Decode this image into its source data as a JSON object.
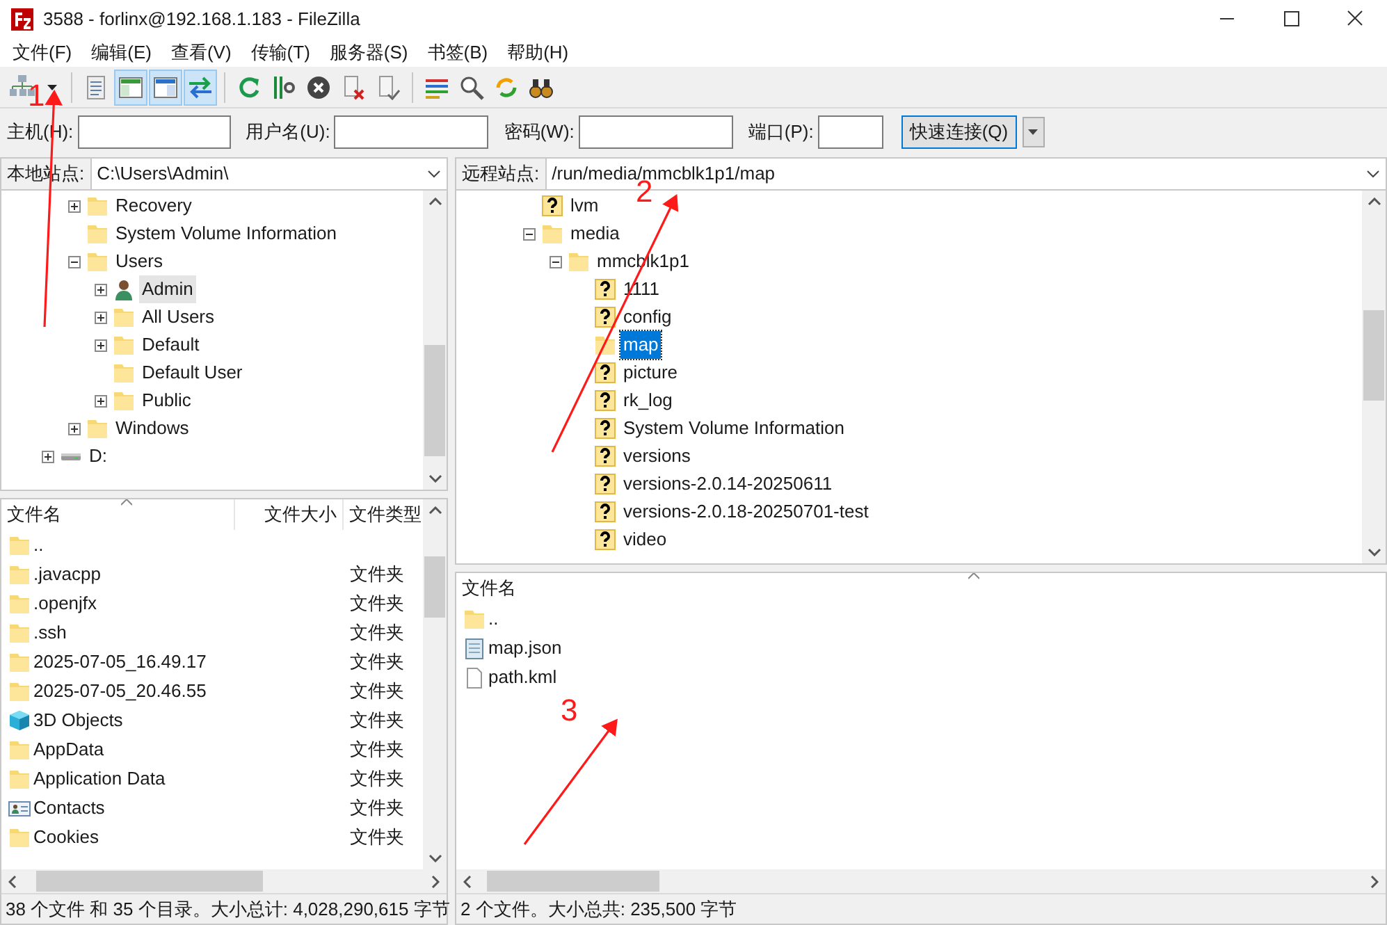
{
  "window": {
    "title": "3588 - forlinx@192.168.1.183 - FileZilla"
  },
  "menu": [
    "文件(F)",
    "编辑(E)",
    "查看(V)",
    "传输(T)",
    "服务器(S)",
    "书签(B)",
    "帮助(H)"
  ],
  "toolbar": [
    {
      "kind": "button",
      "on": false
    },
    {
      "kind": "dropdown"
    },
    {
      "kind": "separator"
    },
    {
      "kind": "button",
      "on": false
    },
    {
      "kind": "button",
      "on": true
    },
    {
      "kind": "button",
      "on": true
    },
    {
      "kind": "button",
      "on": true
    },
    {
      "kind": "separator"
    },
    {
      "kind": "button",
      "on": false
    },
    {
      "kind": "button",
      "on": false
    },
    {
      "kind": "button",
      "on": false
    },
    {
      "kind": "button",
      "on": false
    },
    {
      "kind": "button",
      "on": false
    },
    {
      "kind": "separator"
    },
    {
      "kind": "button",
      "on": false
    },
    {
      "kind": "button",
      "on": false
    },
    {
      "kind": "button",
      "on": false
    },
    {
      "kind": "button",
      "on": false
    }
  ],
  "quickconnect": {
    "fields": [
      {
        "label": "主机(H):"
      },
      {
        "label": "用户名(U):"
      },
      {
        "label": "密码(W):"
      },
      {
        "label": "端口(P):"
      }
    ],
    "button": "快速连接(Q)"
  },
  "local": {
    "label": "本地站点:",
    "path": "C:\\Users\\Admin\\",
    "focused": false,
    "tree": [
      {
        "children": [
          {
            "label": "Recovery",
            "kind": "folder",
            "expanded": false,
            "selected": false
          },
          {
            "label": "System Volume Information",
            "kind": "folder",
            "selected": false
          },
          {
            "label": "Users",
            "kind": "folder",
            "expanded": true,
            "selected": false,
            "children": [
              {
                "label": "Admin",
                "kind": "user",
                "expanded": false,
                "selected": true
              },
              {
                "label": "All Users",
                "kind": "folder",
                "expanded": false,
                "selected": false
              },
              {
                "label": "Default",
                "kind": "folder",
                "expanded": false,
                "selected": false
              },
              {
                "label": "Default User",
                "kind": "folder",
                "selected": false
              },
              {
                "label": "Public",
                "kind": "folder",
                "expanded": false,
                "selected": false
              }
            ]
          },
          {
            "label": "Windows",
            "kind": "folder",
            "expanded": false,
            "selected": false
          }
        ]
      },
      {
        "label": "D:",
        "kind": "drive",
        "expanded": false,
        "selected": false
      }
    ],
    "columns": [
      "文件名",
      "文件大小",
      "文件类型"
    ],
    "files": [
      {
        "name": "..",
        "kind": "folder"
      },
      {
        "name": ".javacpp",
        "kind": "folder",
        "type": "文件夹"
      },
      {
        "name": ".openjfx",
        "kind": "folder",
        "type": "文件夹"
      },
      {
        "name": ".ssh",
        "kind": "folder",
        "type": "文件夹"
      },
      {
        "name": "2025-07-05_16.49.17",
        "kind": "folder",
        "type": "文件夹"
      },
      {
        "name": "2025-07-05_20.46.55",
        "kind": "folder",
        "type": "文件夹"
      },
      {
        "name": "3D Objects",
        "kind": "cube",
        "type": "文件夹"
      },
      {
        "name": "AppData",
        "kind": "folder",
        "type": "文件夹"
      },
      {
        "name": "Application Data",
        "kind": "folder",
        "type": "文件夹"
      },
      {
        "name": "Contacts",
        "kind": "contacts",
        "type": "文件夹"
      },
      {
        "name": "Cookies",
        "kind": "folder",
        "type": "文件夹"
      }
    ],
    "status": "38 个文件 和 35 个目录。大小总计: 4,028,290,615 字节"
  },
  "remote": {
    "label": "远程站点:",
    "path": "/run/media/mmcblk1p1/map",
    "focused": true,
    "tree": [
      {
        "children": [
          {
            "label": "lvm",
            "kind": "unknown",
            "selected": false
          },
          {
            "label": "media",
            "kind": "folder",
            "expanded": true,
            "selected": false,
            "children": [
              {
                "label": "mmcblk1p1",
                "kind": "folder",
                "expanded": true,
                "selected": false,
                "children": [
                  {
                    "label": "1111",
                    "kind": "unknown",
                    "selected": false
                  },
                  {
                    "label": "config",
                    "kind": "unknown",
                    "selected": false
                  },
                  {
                    "label": "map",
                    "kind": "folder",
                    "selected": true
                  },
                  {
                    "label": "picture",
                    "kind": "unknown",
                    "selected": false
                  },
                  {
                    "label": "rk_log",
                    "kind": "unknown",
                    "selected": false
                  },
                  {
                    "label": "System Volume Information",
                    "kind": "unknown",
                    "selected": false
                  },
                  {
                    "label": "versions",
                    "kind": "unknown",
                    "selected": false
                  },
                  {
                    "label": "versions-2.0.14-20250611",
                    "kind": "unknown",
                    "selected": false
                  },
                  {
                    "label": "versions-2.0.18-20250701-test",
                    "kind": "unknown",
                    "selected": false
                  },
                  {
                    "label": "video",
                    "kind": "unknown",
                    "selected": false
                  }
                ]
              }
            ]
          }
        ]
      }
    ],
    "columns": [
      "文件名"
    ],
    "files": [
      {
        "name": "..",
        "kind": "folder"
      },
      {
        "name": "map.json",
        "kind": "text-file"
      },
      {
        "name": "path.kml",
        "kind": "file"
      }
    ],
    "status": "2 个文件。大小总共: 235,500 字节"
  },
  "annotations": [
    {
      "label": "1"
    },
    {
      "label": "2"
    },
    {
      "label": "3"
    }
  ]
}
